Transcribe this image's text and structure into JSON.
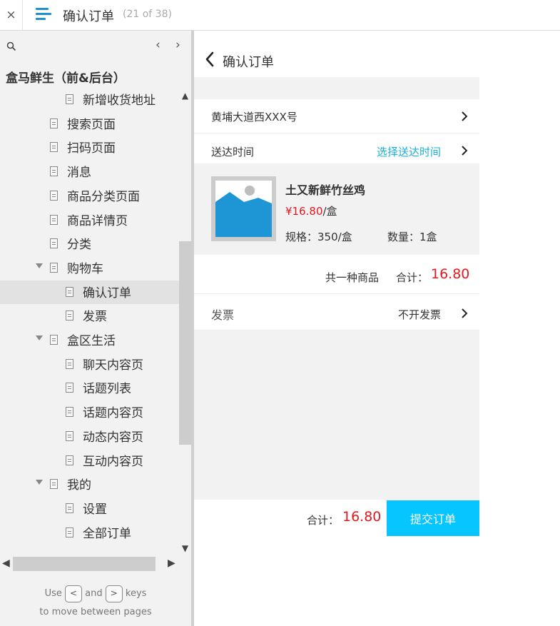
{
  "topbar": {
    "close_label": "×",
    "title": "确认订单",
    "count": "(21 of 38)"
  },
  "sidebar": {
    "project_title": "盒马鲜生（前&后台）",
    "items": [
      {
        "label": "新增收货地址",
        "level": 2,
        "expanded": null,
        "selected": false
      },
      {
        "label": "搜索页面",
        "level": 1,
        "expanded": null,
        "selected": false
      },
      {
        "label": "扫码页面",
        "level": 1,
        "expanded": null,
        "selected": false
      },
      {
        "label": "消息",
        "level": 1,
        "expanded": null,
        "selected": false
      },
      {
        "label": "商品分类页面",
        "level": 1,
        "expanded": null,
        "selected": false
      },
      {
        "label": "商品详情页",
        "level": 1,
        "expanded": null,
        "selected": false
      },
      {
        "label": "分类",
        "level": 1,
        "expanded": null,
        "selected": false
      },
      {
        "label": "购物车",
        "level": 1,
        "expanded": true,
        "selected": false
      },
      {
        "label": "确认订单",
        "level": 2,
        "expanded": null,
        "selected": true
      },
      {
        "label": "发票",
        "level": 2,
        "expanded": null,
        "selected": false
      },
      {
        "label": "盒区生活",
        "level": 1,
        "expanded": true,
        "selected": false
      },
      {
        "label": "聊天内容页",
        "level": 2,
        "expanded": null,
        "selected": false
      },
      {
        "label": "话题列表",
        "level": 2,
        "expanded": null,
        "selected": false
      },
      {
        "label": "话题内容页",
        "level": 2,
        "expanded": null,
        "selected": false
      },
      {
        "label": "动态内容页",
        "level": 2,
        "expanded": null,
        "selected": false
      },
      {
        "label": "互动内容页",
        "level": 2,
        "expanded": null,
        "selected": false
      },
      {
        "label": "我的",
        "level": 1,
        "expanded": true,
        "selected": false
      },
      {
        "label": "设置",
        "level": 2,
        "expanded": null,
        "selected": false
      },
      {
        "label": "全部订单",
        "level": 2,
        "expanded": null,
        "selected": false
      }
    ],
    "hint": {
      "use": "Use",
      "key_prev": "<",
      "and": "and",
      "key_next": ">",
      "keys": "keys",
      "line2": "to move between pages"
    }
  },
  "page": {
    "title": "确认订单",
    "address": "黄埔大道西XXX号",
    "delivery_label": "送达时间",
    "delivery_link": "选择送达时间",
    "product": {
      "name": "土又新鲜竹丝鸡",
      "price": "¥16.80",
      "unit": "/盒",
      "spec": "规格：350/盒",
      "qty": "数量：1盒"
    },
    "summary": {
      "count": "共一种商品",
      "total_label": "合计：",
      "total_value": "16.80"
    },
    "invoice": {
      "label": "发票",
      "value": "不开发票"
    },
    "bottom": {
      "total_label": "合计：",
      "total_value": "16.80",
      "submit": "提交订单"
    }
  },
  "colors": {
    "accent_blue": "#07c5ff",
    "link_blue": "#1ab0d8",
    "price_red": "#e4191e",
    "menu_blue": "#1f8fd6"
  }
}
